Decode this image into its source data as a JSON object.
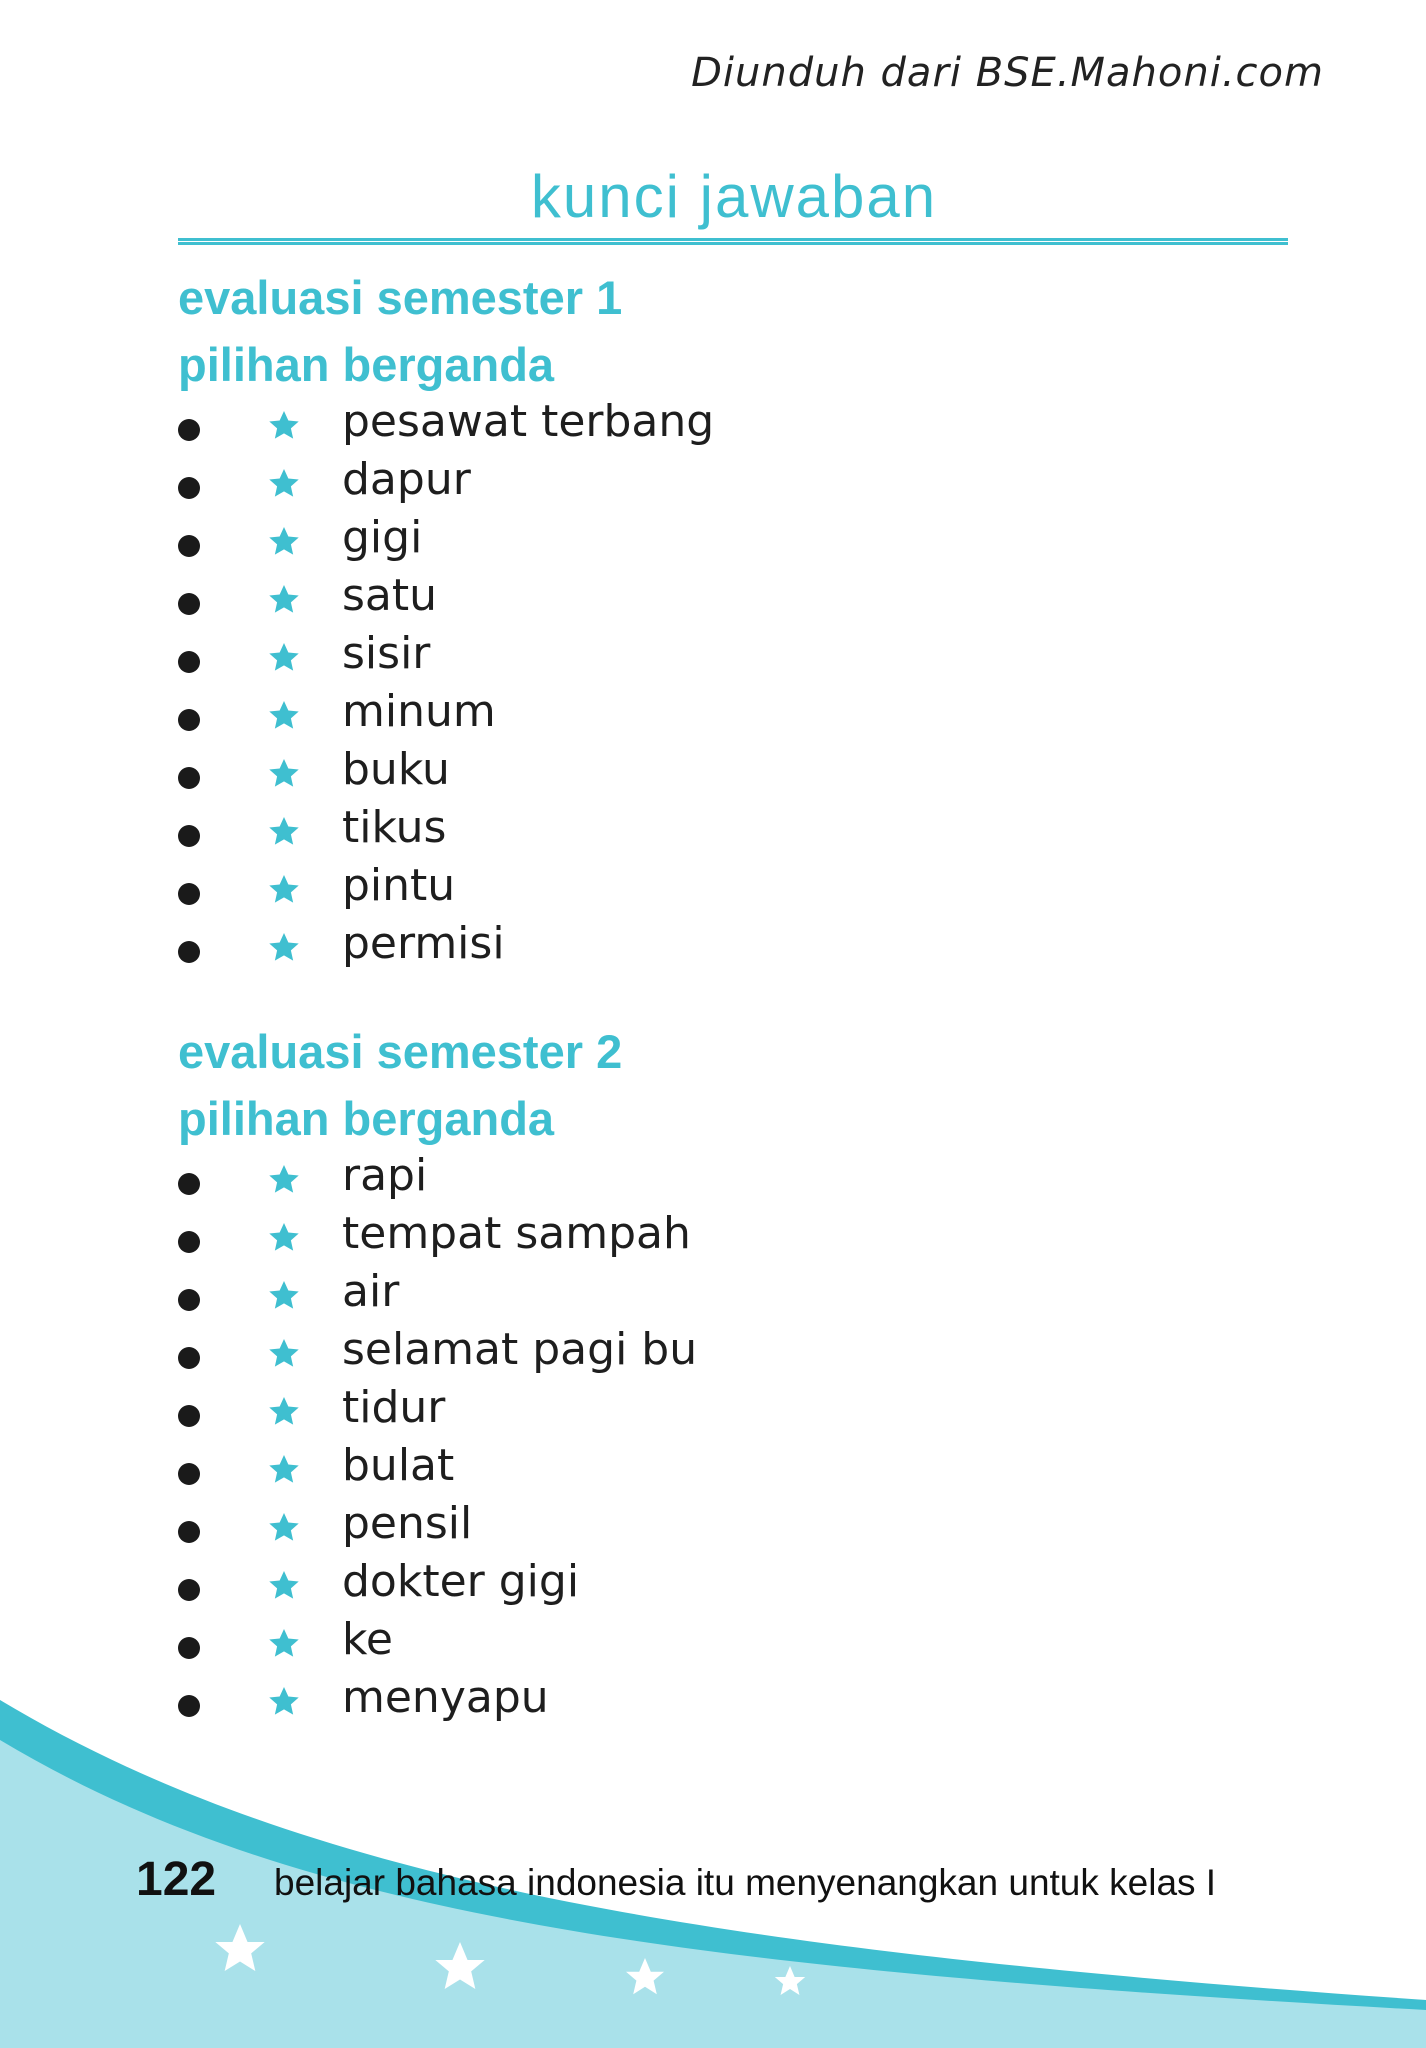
{
  "header": {
    "watermark": "Diunduh dari BSE.Mahoni.com",
    "title": "kunci jawaban"
  },
  "sections": [
    {
      "heading": "evaluasi semester 1",
      "subheading": "pilihan berganda",
      "items": [
        "pesawat terbang",
        "dapur",
        "gigi",
        "satu",
        "sisir",
        "minum",
        "buku",
        "tikus",
        "pintu",
        "permisi"
      ]
    },
    {
      "heading": "evaluasi semester 2",
      "subheading": "pilihan berganda",
      "items": [
        "rapi",
        "tempat sampah",
        "air",
        "selamat pagi bu",
        "tidur",
        "bulat",
        "pensil",
        "dokter gigi",
        "ke",
        "menyapu"
      ]
    }
  ],
  "footer": {
    "page_number": "122",
    "book_title": "belajar bahasa indonesia itu menyenangkan untuk kelas I"
  },
  "colors": {
    "accent": "#3fbfd0",
    "wave_light": "#a9e1ea",
    "wave_dark": "#3fbfd0",
    "text": "#1e1e1e"
  },
  "icons": {
    "bullet": "bullet-dot-icon",
    "marker": "star-icon"
  }
}
